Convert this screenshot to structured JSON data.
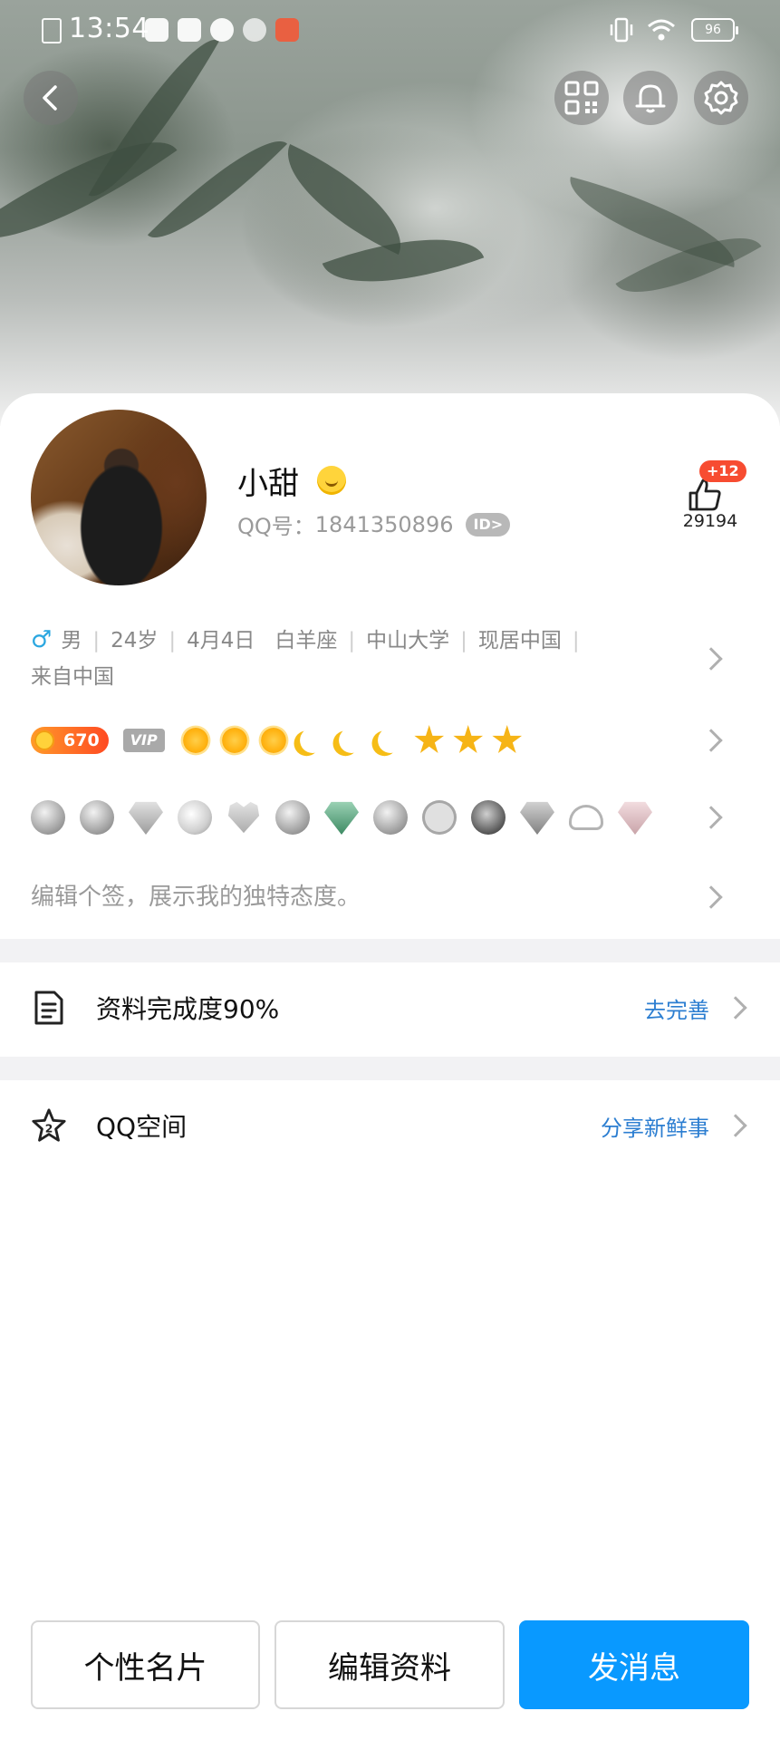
{
  "status_bar": {
    "time": "13:54",
    "battery": "96"
  },
  "profile": {
    "nickname": "小甜",
    "qq_label": "QQ号：",
    "qq_number": "1841350896",
    "id_badge": "ID>",
    "likes_badge": "+12",
    "likes_count": "29194"
  },
  "info": {
    "gender_symbol": "♂",
    "gender": "男",
    "age": "24岁",
    "birthday": "4月4日",
    "zodiac": "白羊座",
    "school": "中山大学",
    "residence": "现居中国",
    "hometown": "来自中国"
  },
  "level": {
    "coin_value": "670",
    "vip_label": "VIP",
    "icons": [
      "sun",
      "sun",
      "sun",
      "moon",
      "moon",
      "moon",
      "star",
      "star",
      "star"
    ]
  },
  "badges": [
    "grey-badge",
    "penguin-badge",
    "diamond-badge",
    "bomb-badge",
    "heart-badge",
    "mountain-badge",
    "green-diamond-badge",
    "mountain-badge",
    "play-badge",
    "penguin-king-badge",
    "grey-diamond-badge",
    "cloud-badge",
    "pink-diamond-badge"
  ],
  "signature_placeholder": "编辑个签，展示我的独特态度。",
  "menu": {
    "completion": {
      "label": "资料完成度90%",
      "action": "去完善",
      "icon": "document-icon"
    },
    "qzone": {
      "label": "QQ空间",
      "action": "分享新鲜事",
      "icon": "star-icon"
    }
  },
  "buttons": {
    "card": "个性名片",
    "edit": "编辑资料",
    "message": "发消息"
  },
  "colors": {
    "primary": "#0999ff",
    "link": "#2c7ed1",
    "like_badge": "#f74c31",
    "male": "#2ba7e0"
  }
}
